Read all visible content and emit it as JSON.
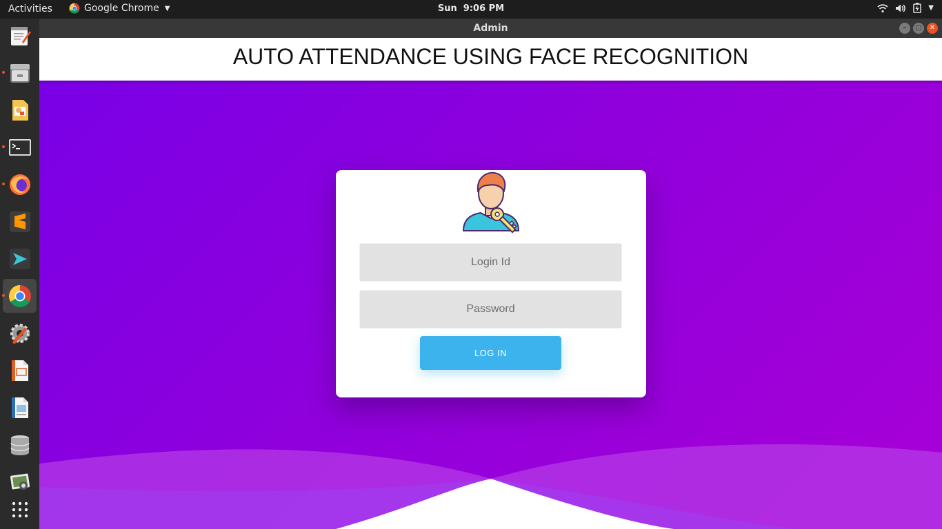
{
  "topbar": {
    "activities": "Activities",
    "app_name": "Google Chrome",
    "clock_day": "Sun",
    "clock_time": "9:06 PM"
  },
  "window": {
    "title": "Admin"
  },
  "page": {
    "heading": "AUTO ATTENDANCE USING FACE RECOGNITION"
  },
  "login_form": {
    "login_placeholder": "Login Id",
    "password_placeholder": "Password",
    "submit_label": "LOG IN"
  },
  "dock": {
    "items": [
      {
        "name": "text-editor-icon"
      },
      {
        "name": "files-icon"
      },
      {
        "name": "image-viewer-icon"
      },
      {
        "name": "terminal-icon"
      },
      {
        "name": "firefox-icon"
      },
      {
        "name": "sublime-text-icon"
      },
      {
        "name": "remote-desktop-icon"
      },
      {
        "name": "chrome-icon"
      },
      {
        "name": "settings-icon"
      },
      {
        "name": "impress-icon"
      },
      {
        "name": "writer-icon"
      },
      {
        "name": "database-icon"
      },
      {
        "name": "photos-icon"
      },
      {
        "name": "show-apps-icon"
      }
    ]
  },
  "colors": {
    "hero_start": "#7a00e6",
    "hero_end": "#a800d6",
    "button": "#3db3ee",
    "accent": "#e95420"
  }
}
